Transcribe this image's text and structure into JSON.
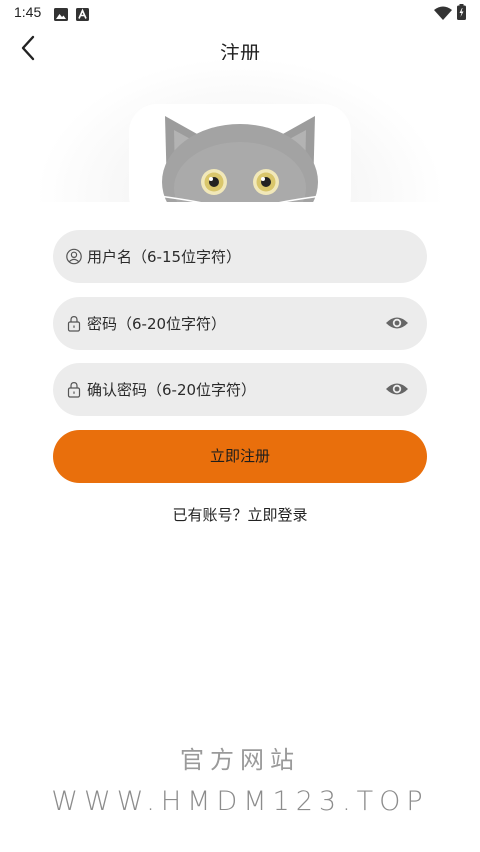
{
  "status_bar": {
    "time": "1:45",
    "icons": [
      "gallery-icon",
      "a-icon",
      "wifi-icon",
      "battery-icon"
    ]
  },
  "header": {
    "back_icon": "chevron-left-icon",
    "title": "注册"
  },
  "hero": {
    "image": "cat-avatar"
  },
  "form": {
    "username": {
      "icon": "user-icon",
      "placeholder": "用户名（6-15位字符）",
      "value": ""
    },
    "password": {
      "icon": "lock-icon",
      "placeholder": "密码（6-20位字符）",
      "value": "",
      "toggle_icon": "eye-icon"
    },
    "confirm_password": {
      "icon": "lock-icon",
      "placeholder": "确认密码（6-20位字符）",
      "value": "",
      "toggle_icon": "eye-icon"
    },
    "submit_label": "立即注册"
  },
  "login_link": "已有账号？立即登录",
  "watermark": {
    "cn": "官方网站",
    "url": "WWW.HMDM123.TOP"
  },
  "colors": {
    "accent": "#e96f0c",
    "field_bg": "#ececec",
    "text": "#222222",
    "watermark": "#8c8c8c"
  }
}
